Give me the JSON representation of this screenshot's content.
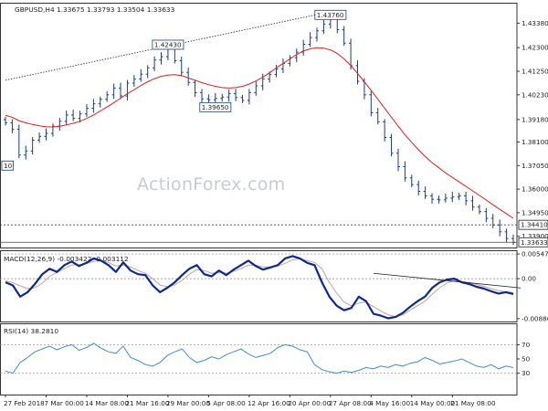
{
  "app": {
    "watermark": "ActionForex.com"
  },
  "colors": {
    "candle": "#1a3d7c",
    "ma": "#e0201c",
    "macd": "#0b2a8f",
    "signal": "#c8a0a0",
    "rsi": "#3b8fd6",
    "grid": "#888888",
    "frame": "#333333"
  },
  "chart_data": [
    {
      "panel": "price",
      "type": "candlestick",
      "header": "GBPUSD,H4  1.33675 1.33793 1.33504 1.33633",
      "ylim": [
        1.334,
        1.443
      ],
      "y_ticks": [
        1.4339,
        1.423,
        1.4125,
        1.402,
        1.391,
        1.381,
        1.3705,
        1.36,
        1.3495,
        1.339
      ],
      "y_tick_labels": [
        "1.43380",
        "1.42300",
        "1.41250",
        "1.40230",
        "1.39180",
        "1.38100",
        "1.37050",
        "1.36000",
        "1.34950",
        "1.33900"
      ],
      "x_ticks": [
        0,
        6,
        12,
        18,
        24,
        30,
        36,
        42,
        48,
        54,
        60,
        66,
        72
      ],
      "x_tick_labels": [
        "27 Feb 2018",
        "7 Mar 00:00",
        "14 Mar 08:00",
        "21 Mar 16:00",
        "29 Mar 00:00",
        "5 Apr 08:00",
        "12 Apr 16:00",
        "20 Apr 00:00",
        "27 Apr 08:00",
        "4 May 16:00",
        "14 May 00:00",
        "21 May 08:00",
        ""
      ],
      "closes": [
        1.3895,
        1.3867,
        1.3752,
        1.377,
        1.3818,
        1.3835,
        1.3848,
        1.388,
        1.3902,
        1.393,
        1.3915,
        1.3935,
        1.396,
        1.398,
        1.4,
        1.402,
        1.405,
        1.4015,
        1.4072,
        1.409,
        1.4112,
        1.414,
        1.4175,
        1.419,
        1.423,
        1.4172,
        1.412,
        1.4075,
        1.403,
        1.4002,
        1.3998,
        1.4004,
        1.401,
        1.4025,
        1.4008,
        1.3995,
        1.403,
        1.406,
        1.409,
        1.411,
        1.4135,
        1.416,
        1.4185,
        1.421,
        1.4245,
        1.4275,
        1.4305,
        1.4335,
        1.437,
        1.431,
        1.425,
        1.415,
        1.408,
        1.402,
        1.394,
        1.39,
        1.383,
        1.376,
        1.37,
        1.365,
        1.362,
        1.359,
        1.357,
        1.3555,
        1.3552,
        1.356,
        1.3565,
        1.357,
        1.3548,
        1.352,
        1.35,
        1.347,
        1.344,
        1.341,
        1.338,
        1.3363
      ],
      "ma": [
        1.3928,
        1.392,
        1.3905,
        1.3895,
        1.3888,
        1.3882,
        1.3878,
        1.3877,
        1.388,
        1.3886,
        1.3893,
        1.3902,
        1.3915,
        1.393,
        1.3948,
        1.3966,
        1.3985,
        1.4005,
        1.4025,
        1.4043,
        1.4062,
        1.4078,
        1.4092,
        1.4102,
        1.4108,
        1.411,
        1.4106,
        1.4095,
        1.4085,
        1.4074,
        1.4065,
        1.4058,
        1.4052,
        1.405,
        1.4052,
        1.4058,
        1.4068,
        1.4082,
        1.4098,
        1.4118,
        1.414,
        1.416,
        1.418,
        1.42,
        1.4215,
        1.4225,
        1.423,
        1.4228,
        1.422,
        1.4204,
        1.418,
        1.415,
        1.4115,
        1.4078,
        1.404,
        1.4,
        1.396,
        1.392,
        1.388,
        1.3842,
        1.3808,
        1.3775,
        1.3745,
        1.3718,
        1.3695,
        1.3672,
        1.3652,
        1.3632,
        1.3612,
        1.3592,
        1.3572,
        1.3552,
        1.353,
        1.351,
        1.349,
        1.347
      ],
      "annotations": [
        {
          "label": "1.42430",
          "index": 24,
          "price": 1.4243
        },
        {
          "label": "1.43760",
          "index": 48,
          "price": 1.4376
        },
        {
          "label": "1.39650",
          "index": 31,
          "price": 1.3965
        },
        {
          "label": "10",
          "index": 0,
          "price": 1.3705
        }
      ],
      "markers": [
        {
          "label": "1.34410",
          "price": 1.3441,
          "style": "dashed"
        },
        {
          "label": "1.33633",
          "price": 1.33633,
          "style": "solid"
        }
      ],
      "trendline": {
        "from_index": 0,
        "from_price": 1.4085,
        "to_index": 48,
        "to_price": 1.439
      }
    },
    {
      "panel": "macd",
      "type": "line",
      "header": "MACD(12,26,9) -0.003422 -0.003112",
      "ylim": [
        -0.0095,
        0.0063
      ],
      "y_ticks": [
        0.00547,
        0.0,
        -0.00886
      ],
      "y_tick_labels": [
        "0.00547",
        "0.00",
        "-0.00886"
      ],
      "macd": [
        -0.0008,
        -0.0015,
        -0.004,
        -0.003,
        -0.0012,
        0.001,
        0.0022,
        0.0015,
        0.003,
        0.0038,
        0.0028,
        0.0035,
        0.0045,
        0.004,
        0.003,
        0.0015,
        0.0036,
        0.0018,
        0.001,
        0.0008,
        -0.0015,
        -0.003,
        -0.002,
        -0.0008,
        0.0008,
        0.0022,
        0.003,
        0.001,
        0.0005,
        0.0018,
        0.0008,
        0.002,
        0.003,
        0.004,
        0.0028,
        0.002,
        0.0025,
        0.003,
        0.0045,
        0.005,
        0.0045,
        0.0035,
        0.003,
        -0.0008,
        -0.004,
        -0.006,
        -0.007,
        -0.0065,
        -0.004,
        -0.005,
        -0.0078,
        -0.0082,
        -0.0088,
        -0.0085,
        -0.0076,
        -0.0062,
        -0.005,
        -0.004,
        -0.002,
        -0.0008,
        -0.0002,
        0.0,
        -0.0008,
        -0.0012,
        -0.0018,
        -0.0022,
        -0.0028,
        -0.0033,
        -0.003,
        -0.0034
      ],
      "signal": [
        -0.0005,
        -0.0009,
        -0.0016,
        -0.0022,
        -0.002,
        -0.001,
        0.0005,
        0.0014,
        0.0022,
        0.003,
        0.0031,
        0.0033,
        0.0038,
        0.004,
        0.0036,
        0.0028,
        0.003,
        0.0026,
        0.0018,
        0.0012,
        0.0,
        -0.0014,
        -0.0018,
        -0.0014,
        -0.0004,
        0.001,
        0.002,
        0.0018,
        0.0012,
        0.0014,
        0.0012,
        0.0016,
        0.0022,
        0.003,
        0.003,
        0.0026,
        0.0026,
        0.0028,
        0.0034,
        0.0042,
        0.0044,
        0.004,
        0.0036,
        0.0022,
        -0.0008,
        -0.0032,
        -0.0052,
        -0.006,
        -0.0054,
        -0.0052,
        -0.0062,
        -0.0072,
        -0.008,
        -0.0084,
        -0.008,
        -0.007,
        -0.006,
        -0.005,
        -0.0034,
        -0.002,
        -0.001,
        -0.0004,
        -0.0006,
        -0.0009,
        -0.0013,
        -0.0017,
        -0.0022,
        -0.0027,
        -0.0029,
        -0.0031
      ],
      "trendline": {
        "from_index": 50,
        "from_value": 0.00118,
        "to_index": 70,
        "to_value": -0.00205
      }
    },
    {
      "panel": "rsi",
      "type": "line",
      "header": "RSI(14) 38.2810",
      "ylim": [
        0,
        100
      ],
      "y_ticks": [
        70,
        50,
        30
      ],
      "y_tick_labels": [
        "70",
        "50",
        "30"
      ],
      "rsi": [
        33,
        30,
        45,
        52,
        60,
        64,
        68,
        63,
        67,
        70,
        62,
        66,
        72,
        65,
        60,
        58,
        68,
        52,
        48,
        42,
        40,
        45,
        55,
        60,
        64,
        52,
        45,
        48,
        53,
        50,
        56,
        60,
        64,
        57,
        52,
        55,
        58,
        66,
        70,
        68,
        63,
        60,
        42,
        35,
        32,
        30,
        33,
        31,
        34,
        38,
        36,
        40,
        38,
        42,
        40,
        44,
        46,
        52,
        48,
        43,
        45,
        47,
        50,
        45,
        40,
        38,
        42,
        36,
        40,
        38
      ]
    }
  ]
}
